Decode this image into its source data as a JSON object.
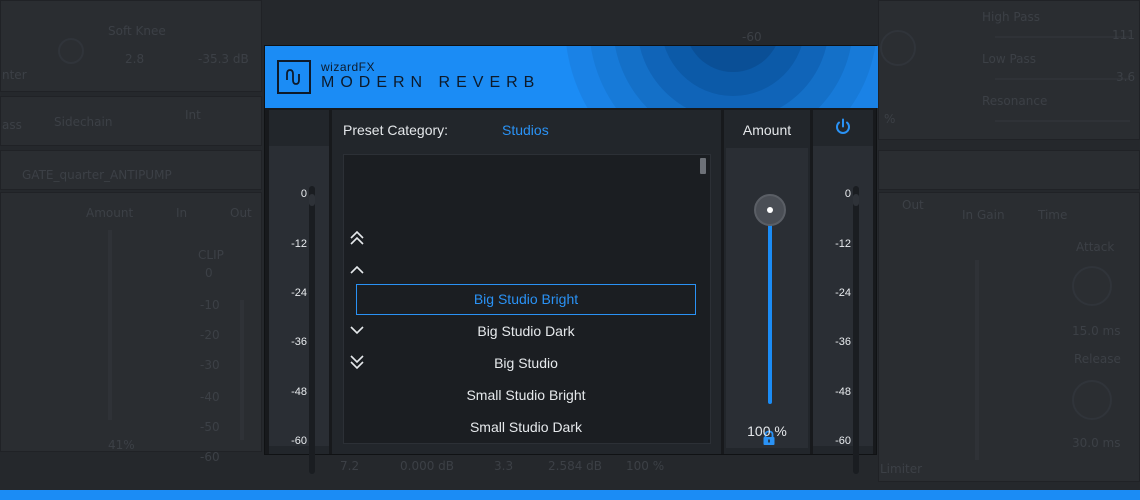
{
  "background": {
    "texts": [
      {
        "label": "Soft Knee"
      },
      {
        "label": "2.8"
      },
      {
        "label": "-35.3 dB"
      },
      {
        "label": "nter"
      },
      {
        "label": "ass"
      },
      {
        "label": "Sidechain"
      },
      {
        "label": "Int"
      },
      {
        "label": "GATE_quarter_ANTIPUMP"
      },
      {
        "label": "Amount"
      },
      {
        "label": "In"
      },
      {
        "label": "Out"
      },
      {
        "label": "CLIP"
      },
      {
        "label": "0"
      },
      {
        "label": "-10"
      },
      {
        "label": "-20"
      },
      {
        "label": "-30"
      },
      {
        "label": "-40"
      },
      {
        "label": "-50"
      },
      {
        "label": "-60"
      },
      {
        "label": "41%"
      },
      {
        "label": "7.2"
      },
      {
        "label": "0.000 dB"
      },
      {
        "label": "3.3"
      },
      {
        "label": "2.584 dB"
      },
      {
        "label": "100 %"
      },
      {
        "label": "High Pass"
      },
      {
        "label": "111"
      },
      {
        "label": "Low Pass"
      },
      {
        "label": "3.6"
      },
      {
        "label": "Resonance"
      },
      {
        "label": "In Gain"
      },
      {
        "label": "Time"
      },
      {
        "label": "Attack"
      },
      {
        "label": "15.0 ms"
      },
      {
        "label": "Release"
      },
      {
        "label": "30.0 ms"
      },
      {
        "label": "Limiter"
      },
      {
        "label": "-60"
      },
      {
        "label": "%"
      },
      {
        "label": "Out"
      }
    ],
    "accent_strip_color": "#1b8cf5"
  },
  "header": {
    "brand": "wizardFX",
    "product": "MODERN REVERB",
    "logo_icon": "sine-wave-icon",
    "color": "#1b8cf5"
  },
  "meters": {
    "left_ticks": [
      "0",
      "-12",
      "-24",
      "-36",
      "-48",
      "-60"
    ],
    "right_ticks": [
      "0",
      "-12",
      "-24",
      "-36",
      "-48",
      "-60"
    ]
  },
  "preset_browser": {
    "category_label": "Preset Category:",
    "category_value": "Studios",
    "nav_icons": [
      "double-chevron-up-icon",
      "chevron-up-icon",
      "chevron-down-icon",
      "double-chevron-down-icon"
    ],
    "presets": [
      {
        "name": "Big Studio Bright",
        "selected": true
      },
      {
        "name": "Big Studio Dark",
        "selected": false
      },
      {
        "name": "Big Studio",
        "selected": false
      },
      {
        "name": "Small Studio Bright",
        "selected": false
      },
      {
        "name": "Small Studio Dark",
        "selected": false
      }
    ]
  },
  "amount": {
    "label": "Amount",
    "value": "100 %",
    "level": 1.0,
    "lock_icon": "lock-icon"
  },
  "power": {
    "icon": "power-icon",
    "on": true,
    "color": "#1b8cf5"
  }
}
